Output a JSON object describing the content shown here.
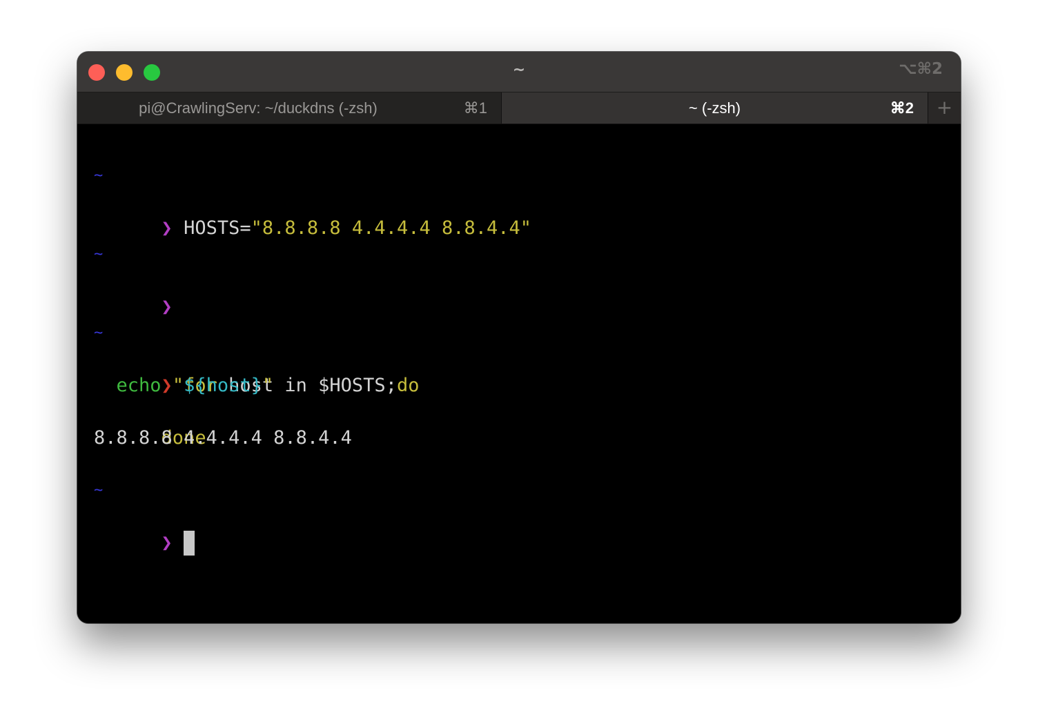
{
  "window": {
    "title": "~",
    "shortcut": "⌥⌘2"
  },
  "tabs": [
    {
      "label": "pi@CrawlingServ: ~/duckdns (-zsh)",
      "key": "⌘1",
      "active": false
    },
    {
      "label": "~ (-zsh)",
      "key": "⌘2",
      "active": true
    }
  ],
  "new_tab_label": "+",
  "colors": {
    "titlebar": "#3a3837",
    "prompt_success": "#b23ec4",
    "prompt_error": "#d03a2a",
    "directory": "#3737d8",
    "string": "#c6bd3c",
    "builtin": "#3fba3f",
    "variable": "#34b8c4"
  },
  "terminal": {
    "blocks": [
      {
        "dir": "~",
        "prompt": "❯",
        "command": {
          "var": "HOSTS=",
          "value": "\"8.8.8.8 4.4.4.4 8.8.4.4\""
        }
      },
      {
        "dir": "~",
        "prompt": "❯"
      },
      {
        "dir": "~",
        "prompt": "❯",
        "loop": {
          "kw_for": "for",
          "rest": " host in $HOSTS;",
          "kw_do": "do",
          "echo": "echo",
          "q_open": "\"",
          "var": "${host}",
          "q_close": "\"",
          "kw_done": "done"
        },
        "output": "8.8.8.8 4.4.4.4 8.8.4.4"
      },
      {
        "dir": "~",
        "prompt": "❯"
      }
    ]
  }
}
